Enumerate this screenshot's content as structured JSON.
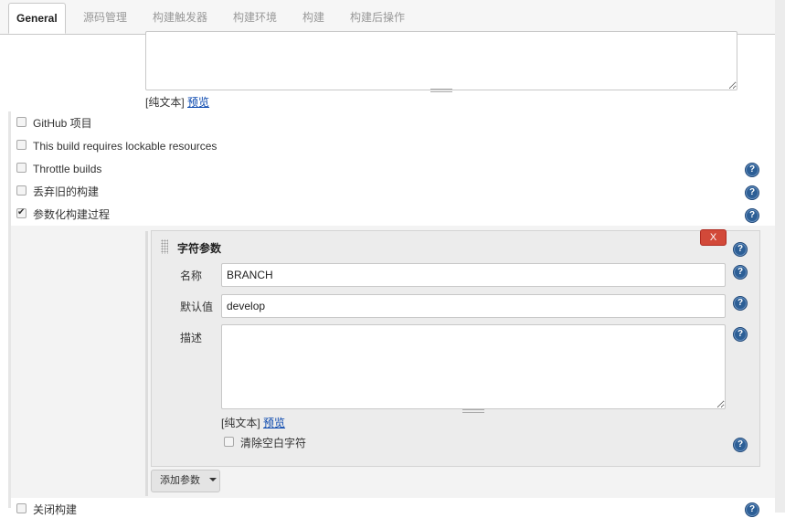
{
  "tabs": [
    "General",
    "源码管理",
    "构建触发器",
    "构建环境",
    "构建",
    "构建后操作"
  ],
  "description_format": {
    "plain_text": "[纯文本]",
    "preview": "预览"
  },
  "options": [
    {
      "label": "GitHub 项目",
      "checked": false
    },
    {
      "label": "This build requires lockable resources",
      "checked": false
    },
    {
      "label": "Throttle builds",
      "checked": false
    },
    {
      "label": "丢弃旧的构建",
      "checked": false
    },
    {
      "label": "参数化构建过程",
      "checked": true
    }
  ],
  "parameter": {
    "title": "字符参数",
    "delete_label": "X",
    "name_label": "名称",
    "name_value": "BRANCH",
    "default_label": "默认值",
    "default_value": "develop",
    "desc_label": "描述",
    "desc_value": "",
    "format": {
      "plain_text": "[纯文本]",
      "preview": "预览"
    },
    "trim_label": "清除空白字符"
  },
  "add_param_label": "添加参数",
  "disable_build_label": "关闭构建",
  "help_glyph": "?"
}
